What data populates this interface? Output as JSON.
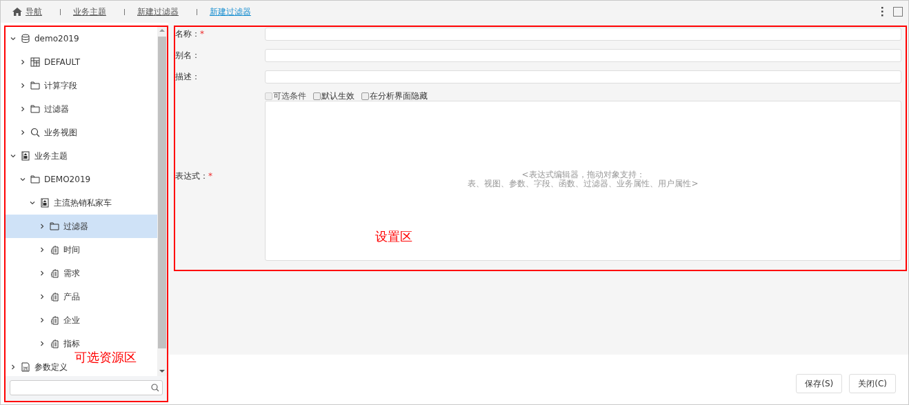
{
  "breadcrumb": [
    {
      "label": "导航",
      "kind": "home",
      "selected": false
    },
    {
      "label": "业务主题",
      "selected": false
    },
    {
      "label": "新建过滤器",
      "selected": false
    },
    {
      "label": "新建过滤器",
      "selected": true
    }
  ],
  "tree": [
    {
      "label": "demo2019",
      "kind": "database",
      "expanded": true,
      "selected": false,
      "children": [
        {
          "label": "DEFAULT",
          "kind": "table",
          "expanded": false,
          "selected": false
        },
        {
          "label": "计算字段",
          "kind": "folder",
          "expanded": false,
          "selected": false
        },
        {
          "label": "过滤器",
          "kind": "folder",
          "expanded": false,
          "selected": false
        },
        {
          "label": "业务视图",
          "kind": "search",
          "expanded": false,
          "selected": false
        }
      ]
    },
    {
      "label": "业务主题",
      "kind": "subject",
      "expanded": true,
      "selected": false,
      "children": [
        {
          "label": "DEMO2019",
          "kind": "folder",
          "expanded": true,
          "selected": false,
          "children": [
            {
              "label": "主流热销私家车",
              "kind": "subject",
              "expanded": true,
              "selected": false,
              "children": [
                {
                  "label": "过滤器",
                  "kind": "folder",
                  "expanded": false,
                  "selected": true
                },
                {
                  "label": "时间",
                  "kind": "dimension",
                  "expanded": false,
                  "selected": false
                },
                {
                  "label": "需求",
                  "kind": "dimension",
                  "expanded": false,
                  "selected": false
                },
                {
                  "label": "产品",
                  "kind": "dimension",
                  "expanded": false,
                  "selected": false
                },
                {
                  "label": "企业",
                  "kind": "dimension",
                  "expanded": false,
                  "selected": false
                },
                {
                  "label": "指标",
                  "kind": "dimension",
                  "expanded": false,
                  "selected": false
                }
              ]
            }
          ]
        }
      ]
    },
    {
      "label": "参数定义",
      "kind": "param",
      "expanded": false,
      "selected": false
    }
  ],
  "annotations": {
    "resource_area": "可选资源区",
    "settings_area": "设置区"
  },
  "form": {
    "fields": [
      {
        "label": "名称：",
        "required": "*"
      },
      {
        "label": "别名："
      },
      {
        "label": "描述："
      }
    ],
    "options": [
      {
        "label": "可选条件",
        "checked": false,
        "disabled": true
      },
      {
        "label": "默认生效",
        "checked": false,
        "disabled": false
      },
      {
        "label": "在分析界面隐藏",
        "checked": false,
        "disabled": false
      }
    ],
    "expression": {
      "label": "表达式：",
      "required": "*",
      "hint_lines": [
        "<表达式编辑器，拖动对象支持：",
        "表、视图、参数、字段、函数、过滤器、业务属性、用户属性>"
      ]
    }
  },
  "buttons": [
    {
      "label": "保存(S)"
    },
    {
      "label": "关闭(C)"
    }
  ]
}
